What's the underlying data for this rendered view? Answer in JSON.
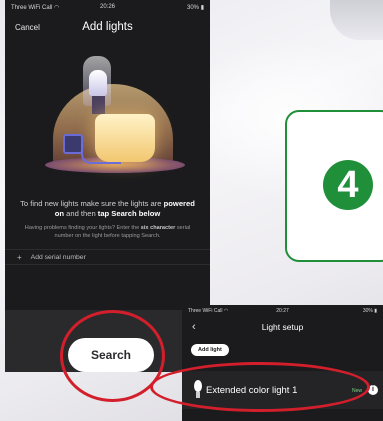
{
  "phone1": {
    "status": {
      "carrier": "Three WiFi Call",
      "time": "20:26",
      "battery": "30%"
    },
    "nav": {
      "cancel_label": "Cancel",
      "title": "Add lights"
    },
    "info_main_pre": "To find new lights make sure the lights are ",
    "info_main_bold1": "powered on",
    "info_main_mid": " and then ",
    "info_main_bold2": "tap Search below",
    "info_sub_pre": "Having problems finding your lights? Enter the ",
    "info_sub_bold": "six character",
    "info_sub_post": " serial number on the light before tapping Search.",
    "add_serial_label": "Add serial number",
    "search_label": "Search"
  },
  "step": {
    "number": "4"
  },
  "phone2": {
    "status": {
      "carrier": "Three WiFi Call",
      "time": "20:27",
      "battery": "30%"
    },
    "nav": {
      "title": "Light setup"
    },
    "add_light_label": "Add light",
    "light": {
      "name": "Extended color light 1",
      "badge": "New"
    }
  },
  "colors": {
    "highlight_ring": "#d21f2b",
    "step_green": "#1f8f3a"
  },
  "icons": [
    "wifi-icon",
    "battery-icon",
    "plus-icon",
    "back-chevron-icon",
    "bulb-icon",
    "info-icon"
  ]
}
